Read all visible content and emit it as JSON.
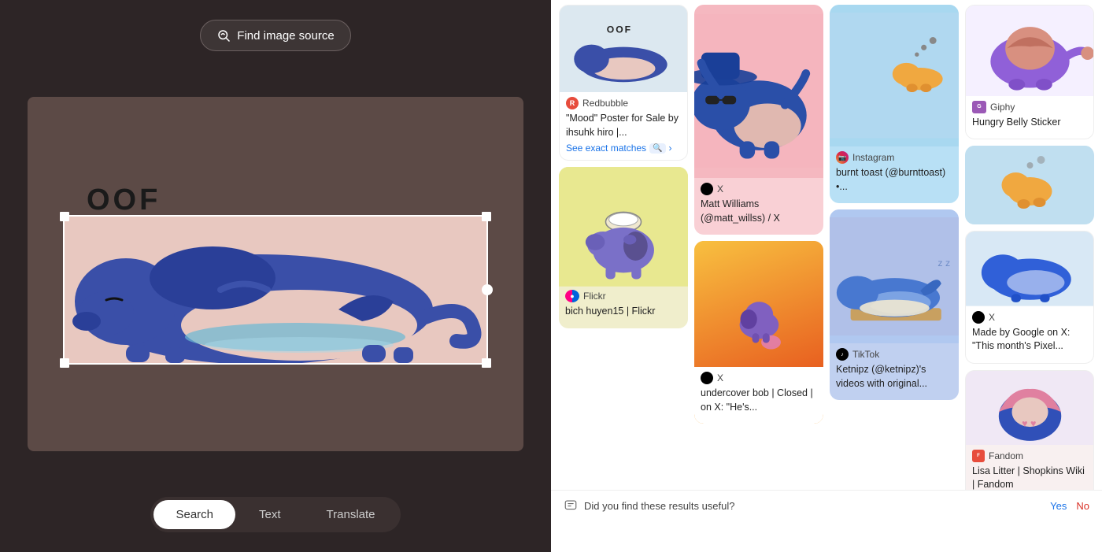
{
  "left": {
    "find_image_label": "Find image source",
    "image_alt": "OOF sleeping creature illustration",
    "oof_text": "OOF",
    "tabs": [
      {
        "id": "search",
        "label": "Search",
        "active": true
      },
      {
        "id": "text",
        "label": "Text",
        "active": false
      },
      {
        "id": "translate",
        "label": "Translate",
        "active": false
      }
    ]
  },
  "right": {
    "col1": {
      "card1": {
        "source": "Redbubble",
        "source_color": "#e74c3c",
        "title": "\"Mood\" Poster for Sale by ihsuhk hiro |...",
        "see_exact": "See exact matches",
        "bg": "white-card"
      },
      "card2": {
        "source": "Flickr",
        "source_color": "#ff6699",
        "title": "bich huyen15 | Flickr",
        "bg": "yellow"
      }
    },
    "col2": {
      "card1": {
        "source": "X",
        "title": "Matt Williams (@matt_willss) / X",
        "bg": "pink"
      },
      "card2": {
        "source": "X",
        "title": "undercover bob | Closed | on X: \"He's...",
        "bg": "orange"
      }
    },
    "col3": {
      "card1": {
        "source": "Instagram",
        "title": "burnt toast (@burnttoast) •...",
        "bg": "blue-light"
      },
      "card2": {
        "source": "TikTok",
        "title": "Ketnipz (@ketnipz)'s videos with original...",
        "bg": "purple-blue"
      }
    },
    "col4": {
      "card1": {
        "source": "Giphy",
        "source_color": "#9b59b6",
        "title": "Hungry Belly Sticker",
        "bg": "white"
      },
      "card2": {
        "source": "",
        "title": "",
        "bg": "blue2"
      },
      "card3": {
        "source": "X",
        "title": "Made by Google on X: \"This month's Pixel...",
        "bg": "blue-gray"
      },
      "card4": {
        "source": "Fandom",
        "source_color": "#e74c3c",
        "title": "Lisa Litter | Shopkins Wiki | Fandom",
        "bg": "gray"
      }
    },
    "feedback": {
      "question": "Did you find these results useful?",
      "yes": "Yes",
      "no": "No"
    }
  }
}
